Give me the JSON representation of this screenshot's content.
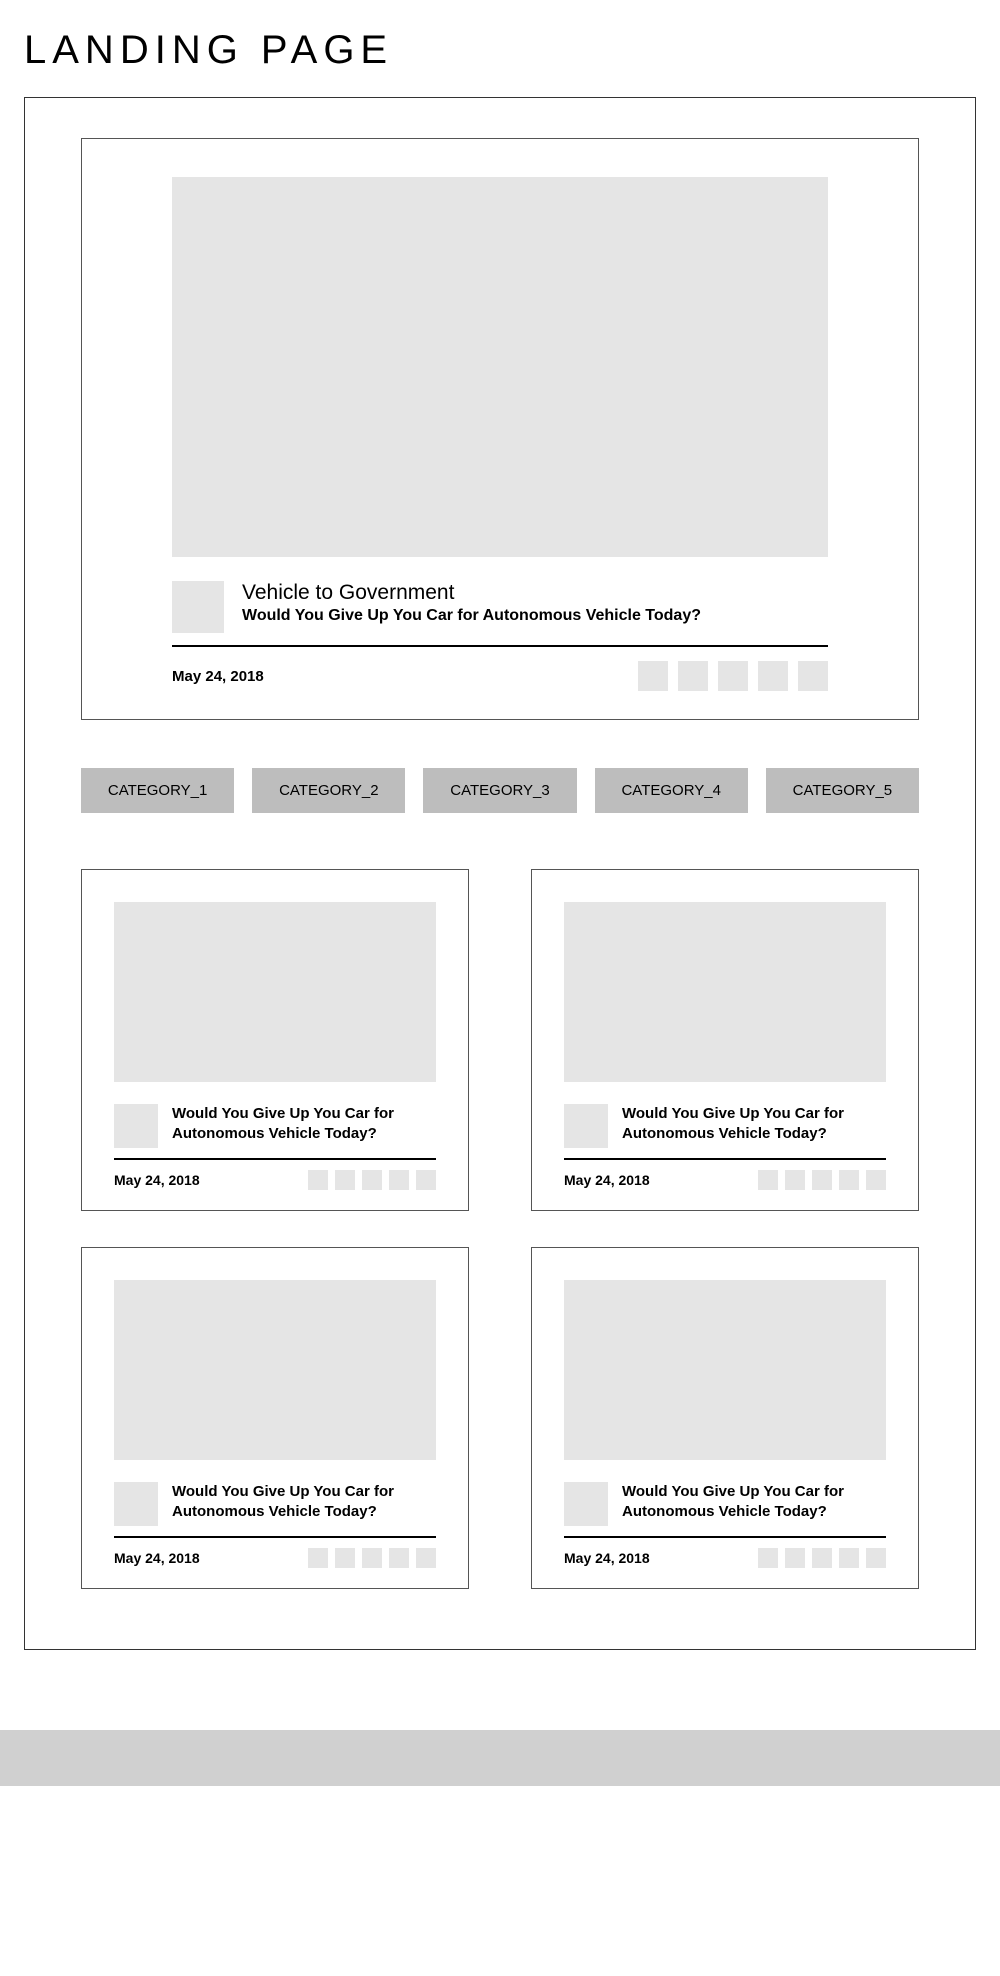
{
  "page_title": "LANDING PAGE",
  "hero": {
    "heading": "Vehicle to Government",
    "subtitle": "Would You Give Up You Car for Autonomous Vehicle Today?",
    "date": "May 24, 2018"
  },
  "categories": [
    {
      "label": "CATEGORY_1"
    },
    {
      "label": "CATEGORY_2"
    },
    {
      "label": "CATEGORY_3"
    },
    {
      "label": "CATEGORY_4"
    },
    {
      "label": "CATEGORY_5"
    }
  ],
  "cards": [
    {
      "title": "Would You Give Up You Car for Autonomous Vehicle Today?",
      "date": "May 24, 2018"
    },
    {
      "title": "Would You Give Up You Car for Autonomous Vehicle Today?",
      "date": "May 24, 2018"
    },
    {
      "title": "Would You Give Up You Car for Autonomous Vehicle Today?",
      "date": "May 24, 2018"
    },
    {
      "title": "Would You Give Up You Car for Autonomous Vehicle Today?",
      "date": "May 24, 2018"
    }
  ]
}
